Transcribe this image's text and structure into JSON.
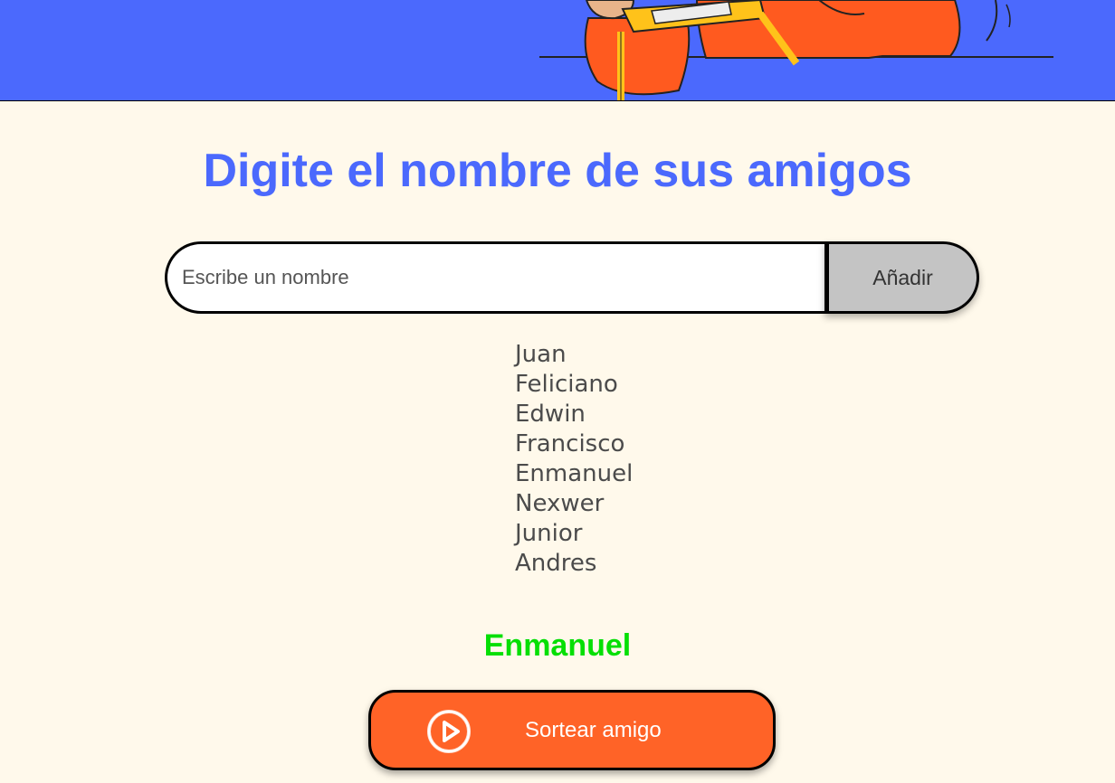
{
  "main": {
    "title": "Digite el nombre de sus amigos"
  },
  "input": {
    "placeholder": "Escribe un nombre",
    "value": ""
  },
  "add_button": {
    "label": "Añadir"
  },
  "friends": [
    "Juan",
    "Feliciano",
    "Edwin",
    "Francisco",
    "Enmanuel",
    "Nexwer",
    "Junior",
    "Andres"
  ],
  "result": {
    "winner": "Enmanuel"
  },
  "draw_button": {
    "label": "Sortear amigo",
    "icon": "play-circle-icon"
  },
  "colors": {
    "header_bg": "#4B69FD",
    "page_bg": "#FFF9EB",
    "title": "#4B69FD",
    "winner": "#05DF05",
    "draw_button_bg": "#FF6327",
    "add_button_bg": "#C4C4C4"
  }
}
